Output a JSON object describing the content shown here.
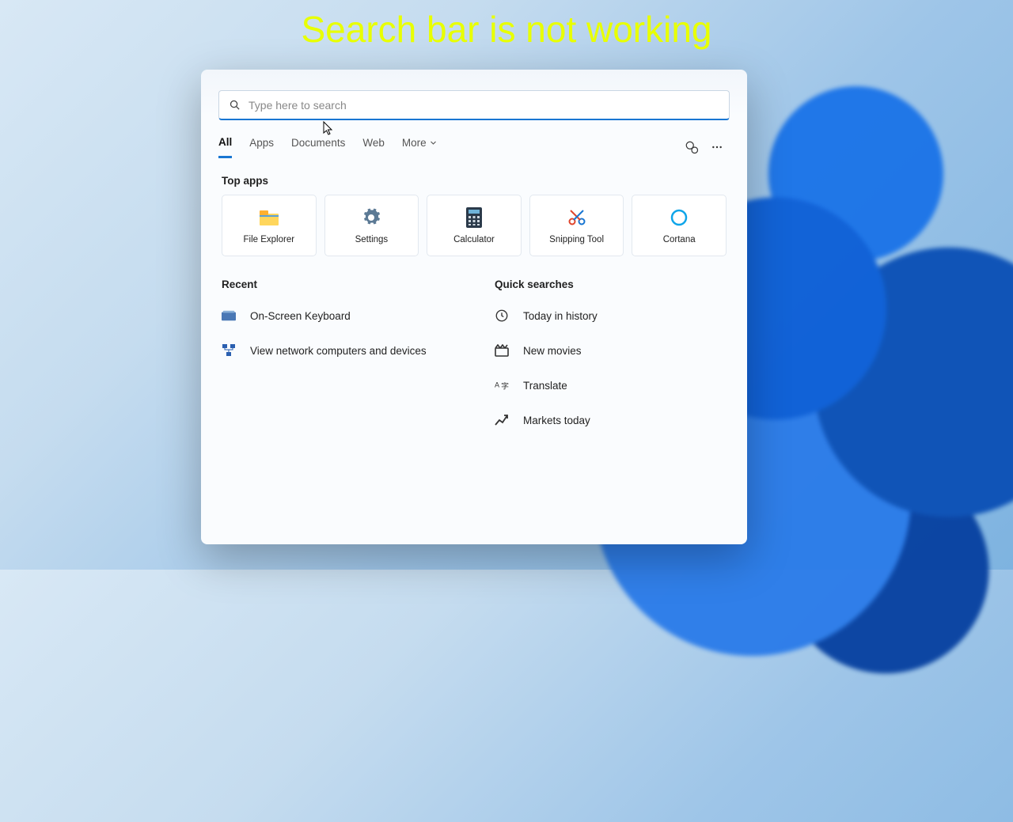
{
  "overlay": {
    "title": "Search bar is not working"
  },
  "search": {
    "placeholder": "Type here to search",
    "value": ""
  },
  "tabs": {
    "all": "All",
    "apps": "Apps",
    "documents": "Documents",
    "web": "Web",
    "more": "More"
  },
  "sections": {
    "top_apps": "Top apps",
    "recent": "Recent",
    "quick_searches": "Quick searches"
  },
  "top_apps": {
    "file_explorer": "File Explorer",
    "settings": "Settings",
    "calculator": "Calculator",
    "snipping_tool": "Snipping Tool",
    "cortana": "Cortana"
  },
  "recent": {
    "osk": "On-Screen Keyboard",
    "network": "View network computers and devices"
  },
  "quick": {
    "today": "Today in history",
    "movies": "New movies",
    "translate": "Translate",
    "markets": "Markets today"
  },
  "colors": {
    "accent": "#1976d2",
    "overlay_text": "#e8ff00"
  }
}
